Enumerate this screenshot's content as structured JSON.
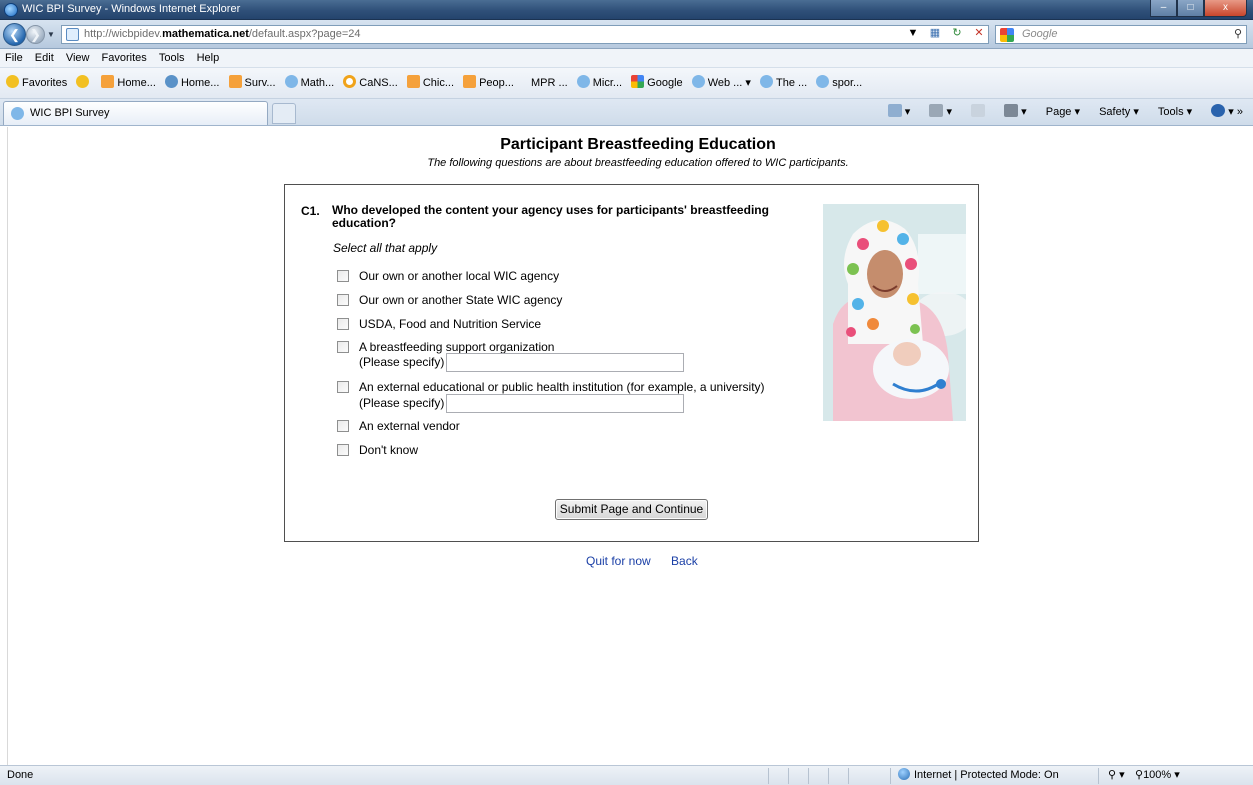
{
  "window": {
    "title": "WIC BPI Survey - Windows Internet Explorer"
  },
  "address": {
    "url_prefix": "http://wicbpidev.",
    "url_domain": "mathematica.net",
    "url_suffix": "/default.aspx?page=24",
    "search_placeholder": "Google"
  },
  "menu": [
    "File",
    "Edit",
    "View",
    "Favorites",
    "Tools",
    "Help"
  ],
  "favorites": {
    "label": "Favorites",
    "items": [
      "Home...",
      "Home...",
      "Surv...",
      "Math...",
      "CaNS...",
      "Chic...",
      "Peop...",
      "MPR ...",
      "Micr...",
      "Google",
      "Web ...",
      "The ...",
      "spor..."
    ]
  },
  "tab": {
    "label": "WIC BPI Survey"
  },
  "commands": {
    "page": "Page",
    "safety": "Safety",
    "tools": "Tools"
  },
  "page": {
    "title": "Participant Breastfeeding Education",
    "subtitle": "The following questions are about breastfeeding education offered to WIC participants."
  },
  "question": {
    "number": "C1.",
    "text": "Who developed the content your agency uses for participants' breastfeeding education?",
    "instruction": "Select all that apply",
    "options": [
      "Our own or another local WIC agency",
      "Our own or another State WIC agency",
      "USDA, Food and Nutrition Service",
      "A breastfeeding support organization",
      "An external educational or public health institution (for example, a university)",
      "An external vendor",
      "Don't know"
    ],
    "specify_label": "(Please specify)"
  },
  "actions": {
    "submit": "Submit Page and Continue",
    "quit": "Quit for now",
    "back": "Back"
  },
  "status": {
    "left": "Done",
    "zone": "Internet | Protected Mode: On",
    "zoom": "100%"
  }
}
